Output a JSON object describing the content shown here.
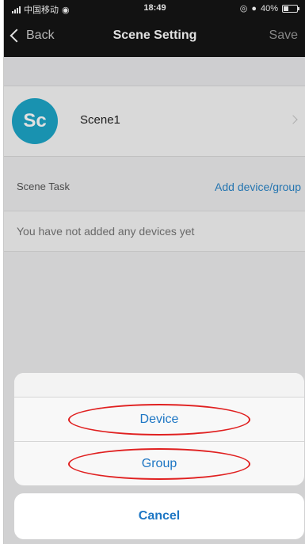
{
  "status_bar": {
    "carrier": "中国移动",
    "time": "18:49",
    "battery": "40%",
    "battery_level": 0.4
  },
  "nav": {
    "back_label": "Back",
    "title": "Scene Setting",
    "save_label": "Save"
  },
  "scene": {
    "avatar_text": "Sc",
    "name": "Scene1",
    "avatar_color": "#1da7c9"
  },
  "task": {
    "label": "Scene Task",
    "add_link": "Add device/group",
    "empty_text": "You have not added any devices yet"
  },
  "action_sheet": {
    "options": [
      {
        "label": "Device"
      },
      {
        "label": "Group"
      }
    ],
    "cancel_label": "Cancel",
    "accent": "#1d76c4",
    "highlight_color": "#e02020"
  }
}
